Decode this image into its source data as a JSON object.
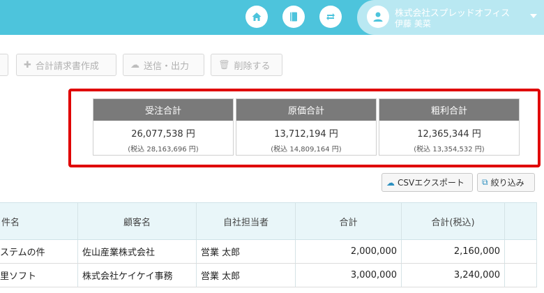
{
  "header": {
    "icons": [
      "home-icon",
      "book-icon",
      "repeat-icon"
    ],
    "user": {
      "company": "株式会社スプレッドオフィス",
      "name": "伊藤 美菜"
    }
  },
  "toolbar": {
    "create_invoice": "合計請求書作成",
    "send_output": "送信・出力",
    "delete": "削除する"
  },
  "summary": [
    {
      "label": "受注合計",
      "value": "26,077,538 円",
      "tax": "(税込 28,163,696 円)"
    },
    {
      "label": "原価合計",
      "value": "13,712,194 円",
      "tax": "(税込 14,809,164 円)"
    },
    {
      "label": "粗利合計",
      "value": "12,365,344 円",
      "tax": "(税込 13,354,532 円)"
    }
  ],
  "actions": {
    "csv_export": "CSVエクスポート",
    "filter": "絞り込み"
  },
  "table": {
    "columns": [
      "件名",
      "顧客名",
      "自社担当者",
      "合計",
      "合計(税込)"
    ],
    "rows": [
      {
        "subject": "ステムの件",
        "customer": "佐山産業株式会社",
        "staff": "営業 太郎",
        "total": "2,000,000",
        "total_tax": "2,160,000"
      },
      {
        "subject": "里ソフト",
        "customer": "株式会社ケイケイ事務",
        "staff": "営業 太郎",
        "total": "3,000,000",
        "total_tax": "3,240,000"
      }
    ]
  }
}
